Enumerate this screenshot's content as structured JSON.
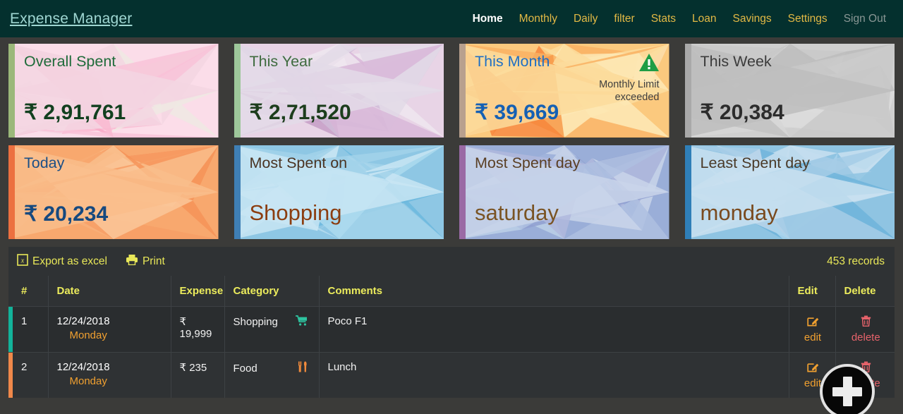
{
  "nav": {
    "brand": "Expense Manager",
    "links": [
      {
        "label": "Home",
        "state": "active"
      },
      {
        "label": "Monthly",
        "state": "normal"
      },
      {
        "label": "Daily",
        "state": "normal"
      },
      {
        "label": "filter",
        "state": "normal"
      },
      {
        "label": "Stats",
        "state": "normal"
      },
      {
        "label": "Loan",
        "state": "normal"
      },
      {
        "label": "Savings",
        "state": "normal"
      },
      {
        "label": "Settings",
        "state": "normal"
      },
      {
        "label": "Sign Out",
        "state": "muted"
      }
    ],
    "bg": "#04302e",
    "link_color": "#e3b945",
    "active_color": "#ffffff",
    "muted_color": "#8a9795"
  },
  "cards": [
    {
      "key": "overall-spent",
      "title": "Overall Spent",
      "value": "₹ 2,91,761",
      "title_color": "#1f6b3a",
      "value_color": "#12401f",
      "edge_color": "#9bb87a",
      "palette": [
        "#f7a8c6",
        "#f8c3d8",
        "#fbdde9",
        "#f3d6e2",
        "#efe9e3",
        "#f9b9d0"
      ]
    },
    {
      "key": "this-year",
      "title": "This Year",
      "value": "₹ 2,71,520",
      "title_color": "#3f6b3f",
      "value_color": "#1c3d1c",
      "edge_color": "#9ec79b",
      "palette": [
        "#c69dc6",
        "#d8b7d8",
        "#e8d4e6",
        "#e3dbe8",
        "#eee6ee",
        "#d0bcd8"
      ]
    },
    {
      "key": "this-month",
      "title": "This Month",
      "value": "₹ 39,669",
      "title_color": "#1f6fc4",
      "value_color": "#1560b4",
      "edge_color": "#b8a08e",
      "palette": [
        "#f79a4a",
        "#f9b163",
        "#fbc97e",
        "#fcdc9c",
        "#fde9b6",
        "#f7863c"
      ],
      "badge": {
        "icon": "warning-triangle",
        "icon_color": "#1f9d45",
        "text": "Monthly Limit exceeded",
        "text_color": "#3e3e3e"
      }
    },
    {
      "key": "this-week",
      "title": "This Week",
      "value": "₹ 20,384",
      "title_color": "#3c3c3c",
      "value_color": "#2c2c2c",
      "edge_color": "#a9a9a9",
      "palette": [
        "#d6d6d6",
        "#c9c9c9",
        "#cfcfcf",
        "#bdbdbd",
        "#dcdcdc",
        "#c2c2c2"
      ]
    },
    {
      "key": "today",
      "title": "Today",
      "value": "₹ 20,234",
      "title_color": "#1c4f86",
      "value_color": "#16497f",
      "edge_color": "#ec7040",
      "palette": [
        "#f8b07a",
        "#f79f66",
        "#f8a86e",
        "#f9bd8b",
        "#f69358",
        "#fac79a"
      ]
    },
    {
      "key": "most-spent-on",
      "title": "Most Spent on",
      "value": "Shopping",
      "title_color": "#4a3423",
      "value_color": "#8b3d10",
      "edge_color": "#3f7fb5",
      "palette": [
        "#b7dcef",
        "#a2d2ea",
        "#8ec7e4",
        "#c8e5f3",
        "#6cb9de",
        "#addbef"
      ],
      "value_style": "text"
    },
    {
      "key": "most-spent-day",
      "title": "Most Spent day",
      "value": "saturday",
      "title_color": "#5a3f24",
      "value_color": "#7a5424",
      "edge_color": "#9a6aa5",
      "palette": [
        "#bcd0e8",
        "#aebfe0",
        "#9aaed8",
        "#c9d5ea",
        "#8f9fd0",
        "#b0b8dd"
      ],
      "value_style": "text"
    },
    {
      "key": "least-spent-day",
      "title": "Least Spent day",
      "value": "monday",
      "title_color": "#4a3a28",
      "value_color": "#7a4a1e",
      "edge_color": "#2f7fb8",
      "palette": [
        "#bcd6ea",
        "#a6cde6",
        "#8fc4e2",
        "#c9e0f0",
        "#6fb4da",
        "#a9d3ec"
      ],
      "value_style": "text"
    }
  ],
  "toolbar": {
    "export_label": "Export as excel",
    "export_icon": "excel-file-icon",
    "print_label": "Print",
    "print_icon": "printer-icon",
    "records_label": "453 records",
    "accent": "#e8e758"
  },
  "table": {
    "columns": [
      "#",
      "Date",
      "Expense",
      "Category",
      "Comments",
      "Edit",
      "Delete"
    ],
    "rows": [
      {
        "index": "1",
        "date": "12/24/2018",
        "day": "Monday",
        "expense": "₹ 19,999",
        "category": "Shopping",
        "category_icon": "shopping-cart-icon",
        "category_icon_color": "#2ec4a0",
        "comments": "Poco F1",
        "edit_label": "edit",
        "delete_label": "delete",
        "mark_color": "#12b39a"
      },
      {
        "index": "2",
        "date": "12/24/2018",
        "day": "Monday",
        "expense": "₹ 235",
        "category": "Food",
        "category_icon": "cutlery-icon",
        "category_icon_color": "#f08a3c",
        "comments": "Lunch",
        "edit_label": "edit",
        "delete_label": "delete",
        "mark_color": "#f0884a"
      }
    ],
    "edit_icon": "pencil-square-icon",
    "delete_icon": "trash-icon"
  },
  "fab": {
    "icon": "plus-icon",
    "label": "add-expense"
  }
}
